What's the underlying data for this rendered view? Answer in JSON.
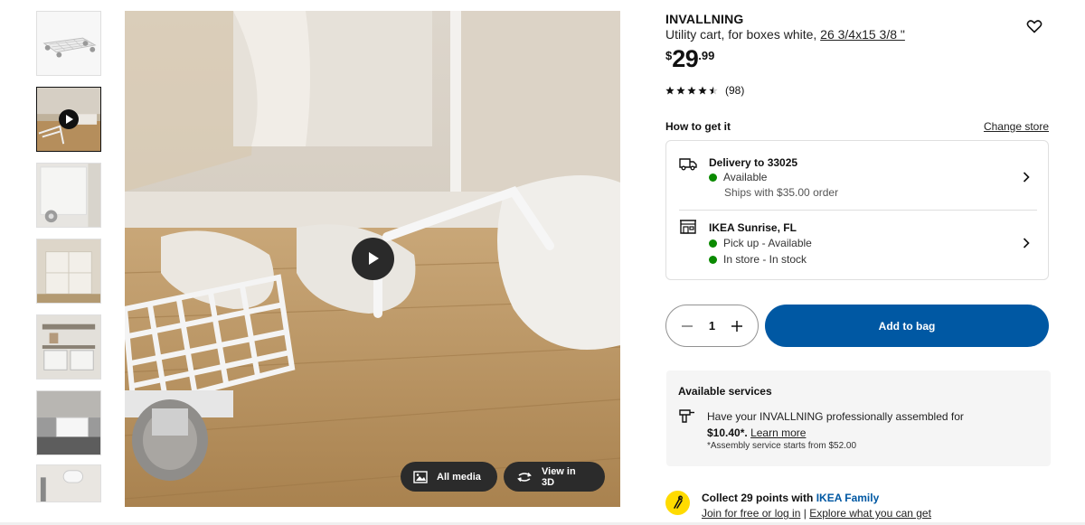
{
  "thumbnails": [
    {
      "name": "thumb-cart-product",
      "kind": "image"
    },
    {
      "name": "thumb-cart-video",
      "kind": "video"
    },
    {
      "name": "thumb-cart-wheel",
      "kind": "image"
    },
    {
      "name": "thumb-cabinet-room",
      "kind": "image"
    },
    {
      "name": "thumb-shelf-boxes",
      "kind": "image"
    },
    {
      "name": "thumb-grey-sofa-boxes",
      "kind": "image"
    },
    {
      "name": "thumb-bathroom",
      "kind": "image"
    }
  ],
  "media": {
    "all_media_label": "All media",
    "view_3d_label": "View in 3D"
  },
  "product": {
    "name": "INVALLNING",
    "description": "Utility cart, for boxes white, ",
    "dimensions": "26 3/4x15 3/8 \"",
    "price_currency": "$",
    "price_integer": "29",
    "price_decimal": ".99",
    "rating_value": 4.5,
    "rating_count": "(98)"
  },
  "how_to_get": {
    "title": "How to get it",
    "change_store": "Change store",
    "delivery": {
      "title": "Delivery to 33025",
      "status": "Available",
      "note": "Ships with $35.00 order"
    },
    "store": {
      "title": "IKEA Sunrise, FL",
      "pickup": "Pick up - Available",
      "instore": "In store - In stock"
    }
  },
  "cart": {
    "quantity": "1",
    "add_label": "Add to bag"
  },
  "services": {
    "title": "Available services",
    "text_prefix": "Have your INVALLNING professionally assembled for ",
    "price": "$10.40*.",
    "learn_more": "Learn more",
    "note": "*Assembly service starts from $52.00"
  },
  "family": {
    "title_prefix": "Collect 29 points with ",
    "title_brand": "IKEA Family",
    "link_join": "Join for free or log in",
    "separator": " | ",
    "link_explore": "Explore what you can get"
  },
  "colors": {
    "accent_blue": "#0058a3",
    "available_green": "#0a8a00",
    "family_yellow": "#ffdb00"
  }
}
